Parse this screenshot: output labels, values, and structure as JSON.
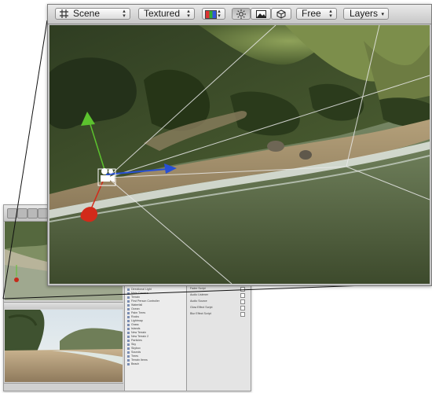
{
  "scene_view": {
    "draw_mode_label": "Scene",
    "render_mode_label": "Textured",
    "camera_mode_label": "Free",
    "layers_label": "Layers",
    "icons": [
      "grid-icon",
      "color-swatch-icon",
      "sun-icon",
      "image-icon",
      "cube-icon"
    ]
  },
  "hierarchy": {
    "items": [
      "Directional Light",
      "Main Camera",
      "Terrain",
      "First Person Controller",
      "Waterfall",
      "Ocean",
      "Palm Trees",
      "Rocks",
      "Lightmap",
      "Grass",
      "Islands",
      "New Terrain",
      "New Terrain 2",
      "Particles",
      "Sky",
      "Skybox",
      "Sounds",
      "Trees",
      "Terrain Items",
      "Beach"
    ]
  },
  "inspector": {
    "rows": [
      "Fader Script",
      "Audio Listener",
      "Audio Source",
      "Glow Effect Script",
      "Blur Effect Script"
    ]
  },
  "colors": {
    "toolbar_top": "#e9e9e9",
    "toolbar_bottom": "#c7c7c7",
    "gizmo_y": "#5cc22e",
    "gizmo_x": "#d22a1a",
    "gizmo_z": "#2750d6"
  }
}
